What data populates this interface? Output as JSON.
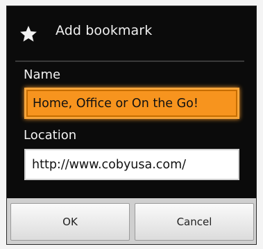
{
  "dialog": {
    "title": "Add bookmark",
    "title_icon": "star-icon"
  },
  "fields": {
    "name_label": "Name",
    "name_value": "Home, Office or On the Go!",
    "location_label": "Location",
    "location_value": "http://www.cobyusa.com/"
  },
  "buttons": {
    "ok_label": "OK",
    "cancel_label": "Cancel"
  },
  "colors": {
    "focus_accent": "#f7941e",
    "dialog_background": "#0b0b0b",
    "button_bar": "#cfcfcf"
  }
}
